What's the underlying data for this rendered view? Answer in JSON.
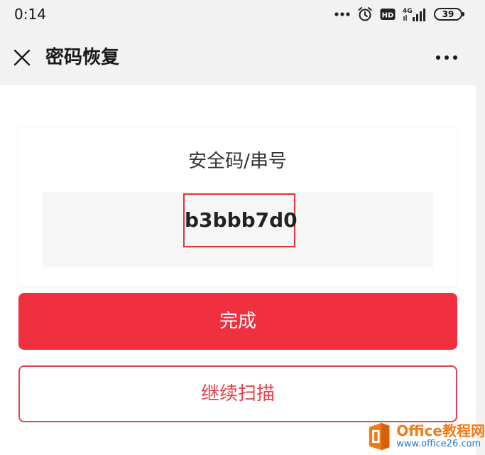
{
  "status_bar": {
    "time": "0:14",
    "network": "4G",
    "hd_badge": "HD",
    "battery": "39"
  },
  "nav": {
    "title": "密码恢复"
  },
  "card": {
    "label": "安全码/串号",
    "code": "b3bbb7d0"
  },
  "buttons": {
    "done": "完成",
    "continue_scan": "继续扫描"
  },
  "watermark": {
    "title": "Office教程网",
    "url": "www.office26.com"
  },
  "colors": {
    "accent": "#f0303e",
    "highlight_border": "#e8333b",
    "watermark_orange": "#f07b16",
    "watermark_blue": "#2878c8"
  }
}
